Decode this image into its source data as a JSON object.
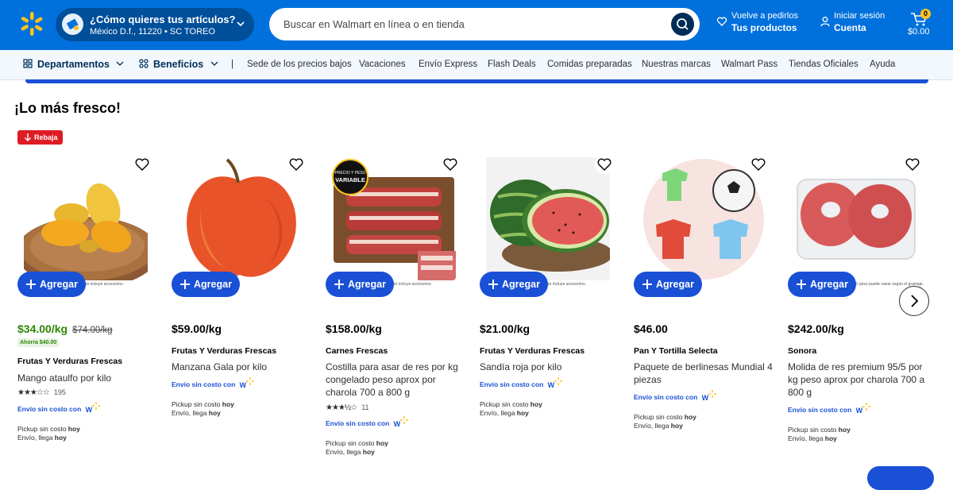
{
  "header": {
    "logo": "spark-logo",
    "ship": {
      "title": "¿Cómo quieres tus artículos?",
      "subtitle": "México D.f., 11220 • SC TOREO"
    },
    "search": {
      "placeholder": "Buscar en Walmart en línea o en tienda"
    },
    "reorder": {
      "line1": "Vuelve a pedirlos",
      "line2": "Tus productos"
    },
    "account": {
      "line1": "Iniciar sesión",
      "line2": "Cuenta"
    },
    "cart": {
      "count": "0",
      "total": "$0.00"
    }
  },
  "nav": {
    "departments": "Departamentos",
    "benefits": "Beneficios",
    "separator": "|",
    "links": [
      "Sede de los precios bajos",
      "Vacaciones",
      "Envío Express",
      "Flash Deals",
      "Comidas preparadas",
      "Nuestras marcas",
      "Walmart Pass",
      "Tiendas Oficiales",
      "Ayuda"
    ]
  },
  "section": {
    "title": "¡Lo más fresco!",
    "badge": "Rebaja"
  },
  "add_label": "Agregar",
  "free_shipping": "Envío sin costo con",
  "wplus_label": "W",
  "pickup_prefix": "Pickup sin costo ",
  "delivery_prefix": "Envío, llega ",
  "today": "hoy",
  "variable_badge": {
    "line1": "PRECIO Y PESO",
    "line2": "VARIABLE"
  },
  "products": [
    {
      "price": "$34.00/kg",
      "old_price": "$74.00/kg",
      "savings": "Ahorra $40.00",
      "brand": "Frutas Y Verduras Frescas",
      "name": "Mango ataulfo por kilo",
      "rating": 3,
      "reviews": "195",
      "note": "No incluye accesorios."
    },
    {
      "price": "$59.00/kg",
      "brand": "Frutas Y Verduras Frescas",
      "name": "Manzana Gala por kilo"
    },
    {
      "price": "$158.00/kg",
      "brand": "Carnes Frescas",
      "name": "Costilla para asar de res por kg congelado peso aprox por charola 700 a 800 g",
      "rating": 3.5,
      "reviews": "11",
      "note": "No incluye accesorios."
    },
    {
      "price": "$21.00/kg",
      "brand": "Frutas Y Verduras Frescas",
      "name": "Sandía roja por kilo",
      "note": "No incluye accesorios."
    },
    {
      "price": "$46.00",
      "brand": "Pan Y Tortilla Selecta",
      "name": "Paquete de berlinesas Mundial 4 piezas"
    },
    {
      "price": "$242.00/kg",
      "brand": "Sonora",
      "name": "Molida de res premium 95/5 por kg peso aprox por charola 700 a 800 g",
      "note": "El peso puede variar según el gramaje."
    }
  ],
  "colors": {
    "brand_blue": "#0071dc",
    "dark_blue": "#004f9a",
    "action_blue": "#1a50d6",
    "sale_green": "#2a8703",
    "rebaja_red": "#de1c24",
    "spark_yellow": "#ffc220"
  }
}
